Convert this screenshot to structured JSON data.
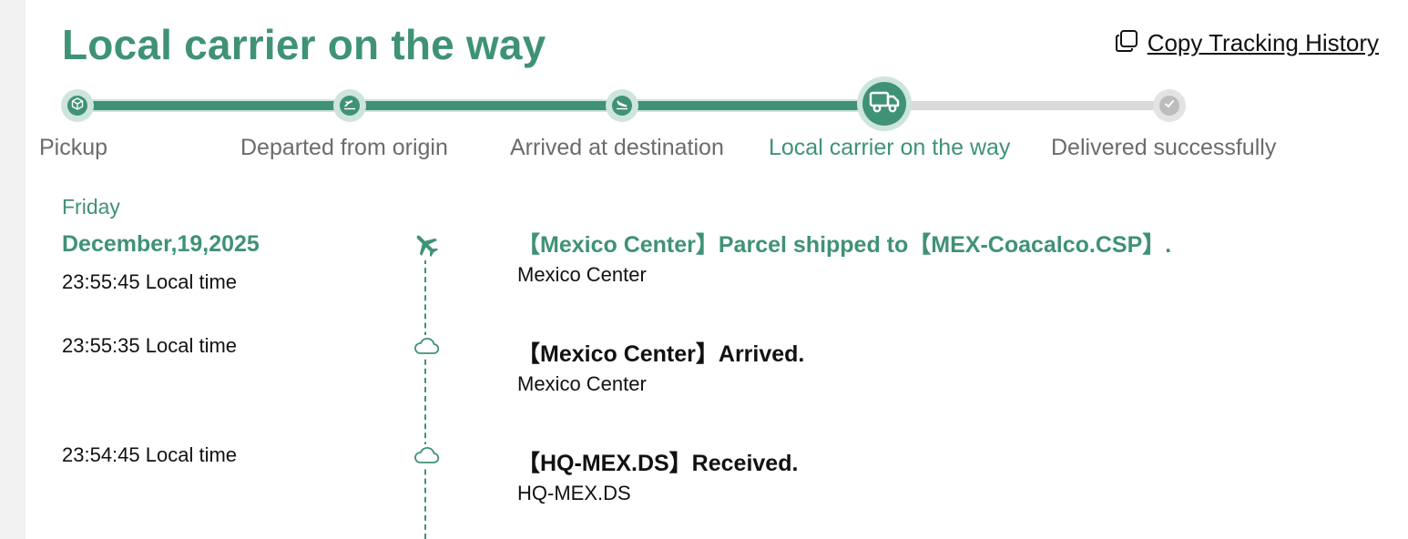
{
  "page": {
    "title": "Local carrier on the way",
    "copy_label": "Copy Tracking History"
  },
  "colors": {
    "accent": "#3f9275",
    "accent_light": "#cde5dc",
    "pending": "#bdbdbd",
    "text": "#111111",
    "muted": "#6b6b6b"
  },
  "progress": {
    "current_step": 4,
    "steps": [
      {
        "label": "Pickup",
        "icon": "box-icon",
        "state": "done"
      },
      {
        "label": "Departed from origin",
        "icon": "plane-departure-icon",
        "state": "done"
      },
      {
        "label": "Arrived at destination",
        "icon": "plane-arrival-icon",
        "state": "done"
      },
      {
        "label": "Local carrier on the way",
        "icon": "truck-icon",
        "state": "current"
      },
      {
        "label": "Delivered successfully",
        "icon": "check-icon",
        "state": "pending"
      }
    ]
  },
  "timeline": {
    "day": "Friday",
    "date": "December,19,2025",
    "events": [
      {
        "time": "23:55:45 Local time",
        "title": "【Mexico Center】Parcel shipped to【MEX-Coacalco.CSP】.",
        "location": "Mexico Center",
        "icon": "plane-icon",
        "latest": true
      },
      {
        "time": "23:55:35 Local time",
        "title": "【Mexico Center】Arrived.",
        "location": "Mexico Center",
        "icon": "cloud-icon",
        "latest": false
      },
      {
        "time": "23:54:45 Local time",
        "title": "【HQ-MEX.DS】Received.",
        "location": "HQ-MEX.DS",
        "icon": "cloud-icon",
        "latest": false
      }
    ]
  }
}
